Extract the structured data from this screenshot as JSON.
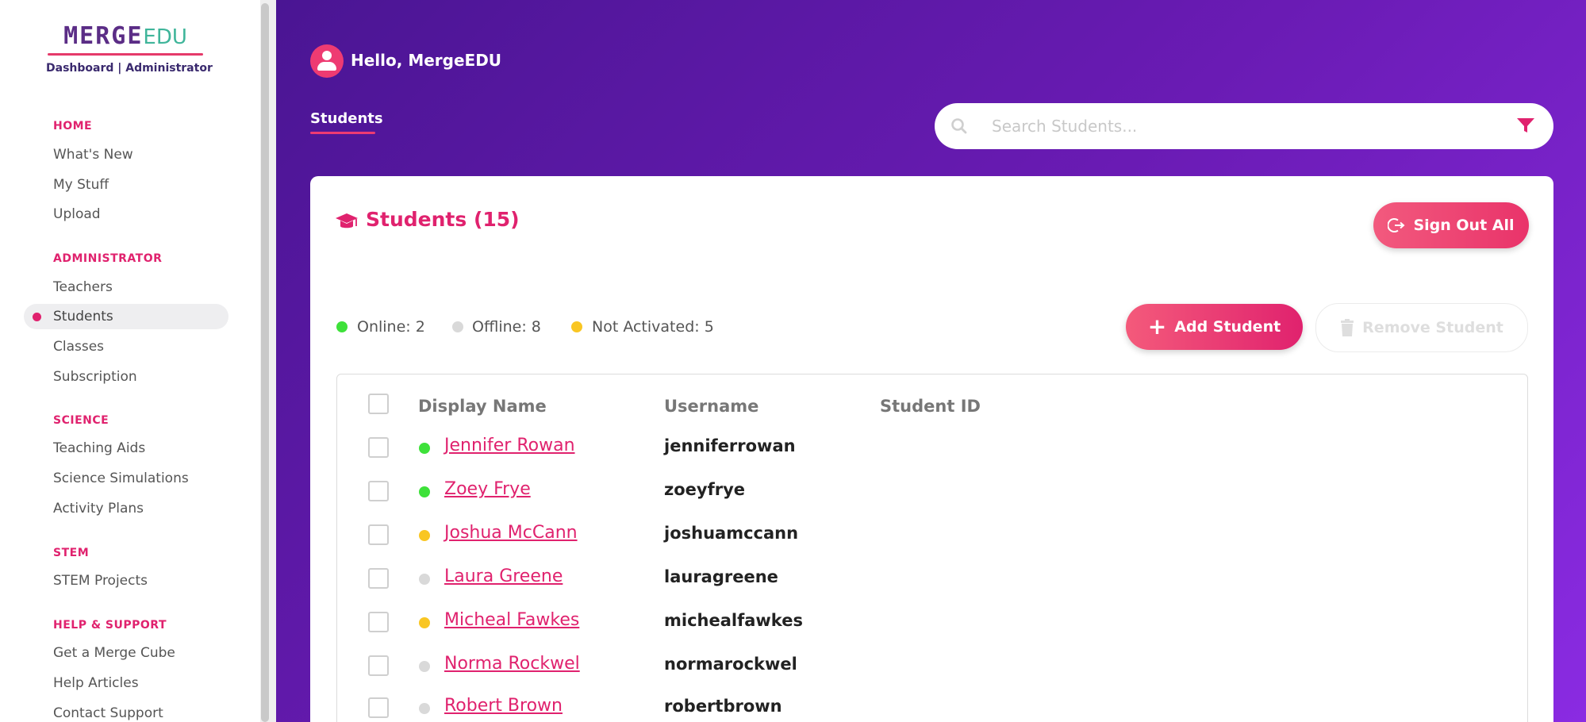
{
  "sidebar": {
    "logo": {
      "merge": "MERGE",
      "edu": "EDU",
      "subtitle": "Dashboard | Administrator"
    },
    "sections": [
      {
        "label": "HOME",
        "items": [
          "What's New",
          "My Stuff",
          "Upload"
        ]
      },
      {
        "label": "ADMINISTRATOR",
        "items": [
          "Teachers",
          "Students",
          "Classes",
          "Subscription"
        ]
      },
      {
        "label": "SCIENCE",
        "items": [
          "Teaching Aids",
          "Science Simulations",
          "Activity Plans"
        ]
      },
      {
        "label": "STEM",
        "items": [
          "STEM Projects"
        ]
      },
      {
        "label": "HELP & SUPPORT",
        "items": [
          "Get a Merge Cube",
          "Help Articles",
          "Contact Support"
        ]
      }
    ],
    "active_item": "Students"
  },
  "header": {
    "greeting": "Hello, MergeEDU",
    "tab": "Students",
    "search": {
      "placeholder": "Search Students...",
      "value": ""
    }
  },
  "card": {
    "title": "Students (15)",
    "sign_out_all": "Sign Out All",
    "add_student": "Add Student",
    "remove_student": "Remove Student",
    "legend": [
      {
        "label": "Online: 2",
        "color": "#3ee13a"
      },
      {
        "label": "Offline: 8",
        "color": "#d9d9d9"
      },
      {
        "label": "Not Activated: 5",
        "color": "#f9c623"
      }
    ],
    "columns": [
      "Display Name",
      "Username",
      "Student ID"
    ],
    "rows": [
      {
        "name": "Jennifer Rowan",
        "username": "jenniferrowan",
        "status": "online",
        "status_color": "#3ee13a"
      },
      {
        "name": "Zoey Frye",
        "username": "zoeyfrye",
        "status": "online",
        "status_color": "#3ee13a"
      },
      {
        "name": "Joshua McCann",
        "username": "joshuamccann",
        "status": "not-activated",
        "status_color": "#f9c623"
      },
      {
        "name": "Laura Greene",
        "username": "lauragreene",
        "status": "offline",
        "status_color": "#d9d9d9"
      },
      {
        "name": "Micheal Fawkes",
        "username": "michealfawkes",
        "status": "not-activated",
        "status_color": "#f9c623"
      },
      {
        "name": "Norma Rockwel",
        "username": "normarockwel",
        "status": "offline",
        "status_color": "#d9d9d9"
      },
      {
        "name": "Robert Brown",
        "username": "robertbrown",
        "status": "offline",
        "status_color": "#d9d9d9"
      }
    ]
  },
  "colors": {
    "accent": "#e0226e",
    "purple": "#6a1bb4",
    "online": "#3ee13a",
    "offline": "#d9d9d9",
    "not_activated": "#f9c623"
  },
  "icons": {
    "avatar": "user-avatar-icon",
    "search": "search-icon",
    "filter": "filter-icon",
    "title": "graduation-cap-icon",
    "sign_out": "sign-out-icon",
    "add": "plus-icon",
    "remove": "trash-icon"
  }
}
